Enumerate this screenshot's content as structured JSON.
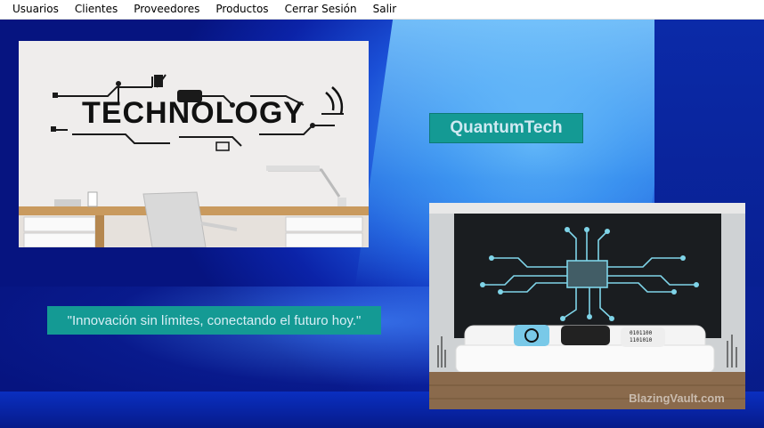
{
  "menu": {
    "items": [
      {
        "label": "Usuarios"
      },
      {
        "label": "Clientes"
      },
      {
        "label": "Proveedores"
      },
      {
        "label": "Productos"
      },
      {
        "label": "Cerrar Sesión"
      },
      {
        "label": "Salir"
      }
    ]
  },
  "main": {
    "brand": "QuantumTech",
    "slogan": "\"Innovación sin límites, conectando el futuro hoy.\"",
    "tech_image_text": "TECHNOLOGY",
    "living_image_watermark": "BlazingVault.com"
  },
  "colors": {
    "label_bg": "#149a94",
    "background": "#0a1a8c"
  }
}
